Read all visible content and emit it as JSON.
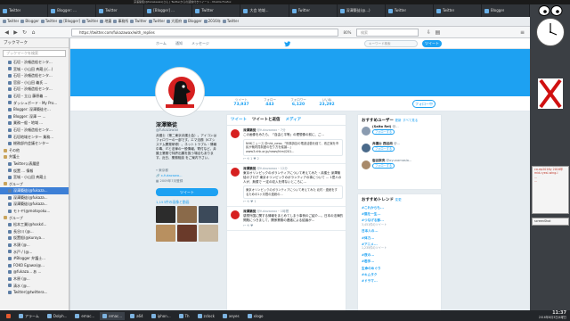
{
  "window_title": "深澤築徒(@fukazawax)さん | Twitterからの返信付きツイート - Mozilla Firefox",
  "tabs": [
    {
      "label": "Twitter"
    },
    {
      "label": "Blogger: ..."
    },
    {
      "label": "Twitter"
    },
    {
      "label": "[Blogger] ..."
    },
    {
      "label": "Twitter"
    },
    {
      "label": "大会 地域..."
    },
    {
      "label": "Twitter"
    },
    {
      "label": "深澤築徒(@...)"
    },
    {
      "label": "Twitter"
    },
    {
      "label": "Twitter"
    },
    {
      "label": "Blogger"
    }
  ],
  "bookmarks": [
    "Twitter",
    "Blogger",
    "Twitter",
    "[Blogger]",
    "Twitter",
    "地震",
    "事務所",
    "Twitter",
    "Twitter",
    "大阪府",
    "Blogger",
    "2016年",
    "Twitter"
  ],
  "nav": {
    "url": "https://twitter.com/fukazawax/with_replies",
    "zoom": "80%",
    "search_placeholder": "検索"
  },
  "sidebar": {
    "title": "ブックマーク",
    "search_placeholder": "ブックマークを検索",
    "items": [
      {
        "label": "石垣・渋噛造船センタ...",
        "kind": "link"
      },
      {
        "label": "宮城・小山田 斉蔵士(...)",
        "kind": "link"
      },
      {
        "label": "石垣・渋噛造船センタ...",
        "kind": "link"
      },
      {
        "label": "官邸・小山田 義氏 ...",
        "kind": "link"
      },
      {
        "label": "石垣・渋噛造船センタ...",
        "kind": "link"
      },
      {
        "label": "石垣・立山 藤原義 ...",
        "kind": "link"
      },
      {
        "label": "ダッシュボード - My Pro...",
        "kind": "link"
      },
      {
        "label": "Blogger: 深澤築徒セ...",
        "kind": "link"
      },
      {
        "label": "Blogger: 深澤 一 ...",
        "kind": "link"
      },
      {
        "label": "業務一般・地域 ...",
        "kind": "link"
      },
      {
        "label": "石垣・渋噛造船センタ...",
        "kind": "link"
      },
      {
        "label": "石垣地域センター 業務...",
        "kind": "link"
      },
      {
        "label": "総務部内会議センター",
        "kind": "link"
      },
      {
        "label": "その他",
        "kind": "folder"
      },
      {
        "label": "弁護士",
        "kind": "folder"
      },
      {
        "label": "Twitter公表履歴",
        "kind": "link"
      },
      {
        "label": "仮置 ... 情報",
        "kind": "link"
      },
      {
        "label": "宮城・小山田 斉蔵士",
        "kind": "link"
      },
      {
        "label": "グループ",
        "kind": "folder"
      },
      {
        "label": "深澤築徒(@fukaza...",
        "kind": "link",
        "selected": true
      },
      {
        "label": "深澤築徒(@fukaza...",
        "kind": "link"
      },
      {
        "label": "深澤築徒(@fukaza...",
        "kind": "link"
      },
      {
        "label": "モトヤ(@motoyoku...",
        "kind": "link"
      },
      {
        "label": "グループ",
        "kind": "folder"
      },
      {
        "label": "松本工業(@hoskd...",
        "kind": "link"
      },
      {
        "label": "長谷川 (@...",
        "kind": "link"
      },
      {
        "label": "仮置船(@kuroya...",
        "kind": "link"
      },
      {
        "label": "木頭 (@...",
        "kind": "link"
      },
      {
        "label": "水戸 / (@...",
        "kind": "link"
      },
      {
        "label": "#Blogger 弁護士...",
        "kind": "link"
      },
      {
        "label": "FOKO Egawa(@...",
        "kind": "link"
      },
      {
        "label": "@fukaza... あ ...",
        "kind": "link"
      },
      {
        "label": "木原 (@...",
        "kind": "link"
      },
      {
        "label": "清水 (@...",
        "kind": "link"
      },
      {
        "label": "Twitter(@twittera...",
        "kind": "link"
      }
    ]
  },
  "twitter": {
    "nav_items": [
      "ホーム",
      "通知",
      "メッセージ"
    ],
    "search_placeholder": "キーワード検索",
    "tweet_button": "ツイート",
    "stats": [
      {
        "label": "ツイート",
        "value": "73,937"
      },
      {
        "label": "フォロー",
        "value": "443"
      },
      {
        "label": "フォロワー",
        "value": "6,120"
      },
      {
        "label": "いいね",
        "value": "23,292"
      }
    ],
    "follow_button": "フォロー中",
    "profile": {
      "name": "深澤築徒",
      "handle": "@fukazawax",
      "bio": "弁護士（第二東京弁護士会）。アイコンはフォロワーの一部です。エマ法務（ICTシステム開発研修）。ネットトラブル・情報中毒、ITと法律の一般情報。寄付など。弁護士業務で特許出願を扱う場合もあります。近日、業務相談 をご案内下さい。",
      "location": "東京都",
      "link": "x-fukazawa...",
      "joined": "2009年7月登録",
      "tweet_to": "ツイート",
      "media_label": "1,153件の画像と動画"
    },
    "timeline_tabs": [
      "ツイート",
      "ツイートと返信",
      "メディア"
    ],
    "tweets": [
      {
        "name": "深澤築徒",
        "handle": "@fukazawax",
        "time": "7分",
        "text": "この画像をみたら、「自由と平等」の理想像の前に、ご…",
        "card": "NHKニュース @nhk_news 「刑事訴訟の電波活動を経て、改正案を市民が裁判員制度の在り方を議論…」 www3.nhk.or.jp/news/html/201…",
        "acts": "↩  ⟲ 1  ♥ 2"
      },
      {
        "name": "深澤築徒",
        "handle": "@fukazawax",
        "time": "12分",
        "text": "東京オリンピックのボランティアについて考えてみた・弁護士 深澤築徒のブログ 東京オリンピックのボランティアの事について … 1億人の人が、無償で 一定の収入を得ないところに…",
        "card": "東京オリンピックのボランティアについて考えてみた 北村・連続をするための1ヶ月間の連続の…",
        "acts": "↩  ⟲  ♥ 1"
      },
      {
        "name": "深澤築徒",
        "handle": "@fukazawax",
        "time": "1時間",
        "text": "感想外国に関する情報をまとめてしまう事例のご紹介…。日本の法律的問題につきまして、関係業務の連絡による結論が…",
        "card": "",
        "acts": "↩  ⟲  ♥"
      }
    ],
    "wtf": {
      "title": "おすすめユーザー",
      "refresh": "更新",
      "all": "すべて見る",
      "users": [
        {
          "name": "(Saito Rei)",
          "handle": "@...",
          "action": "フォローする"
        },
        {
          "name": "弁護士 西谷尚",
          "handle": "@...",
          "action": "フォローする"
        },
        {
          "name": "岩谷奈央",
          "handle": "@oyunamasia...",
          "action": "フォローする"
        }
      ]
    },
    "trends": {
      "title": "おすすめトレンド",
      "change": "変更",
      "items": [
        {
          "topic": "#これからも...",
          "count": ""
        },
        {
          "topic": "#猫を一生...",
          "count": ""
        },
        {
          "topic": "#つなげる部...",
          "count": "3,451件のツイート"
        },
        {
          "topic": "日本人の...",
          "count": ""
        },
        {
          "topic": "#体力...",
          "count": ""
        },
        {
          "topic": "#アニメ...",
          "count": "1,235件のツイート"
        },
        {
          "topic": "#夜の...",
          "count": ""
        },
        {
          "topic": "#若手...",
          "count": ""
        },
        {
          "topic": "生命のめぐり",
          "count": ""
        },
        {
          "topic": "#キムタク",
          "count": ""
        },
        {
          "topic": "#ドラマ...",
          "count": ""
        }
      ]
    }
  },
  "desktop": {
    "side_list": [
      "co-ep2016y 2016年",
      "mid-ryesl-wing-l",
      "...",
      "..."
    ],
    "screenshot_label": "screenShot"
  },
  "taskbar": {
    "items": [
      "",
      "アラーム",
      "Dolph...",
      "emac...",
      "emac...",
      "a64",
      "iphon...",
      "Th",
      "zclock",
      "xeyes",
      "xlogo"
    ],
    "time": "11:37",
    "date": "2016年8月3日水曜日"
  },
  "colors": {
    "twitter_blue": "#1da1f2",
    "tab_bar": "#2f3338",
    "taskbar": "#23262a"
  }
}
